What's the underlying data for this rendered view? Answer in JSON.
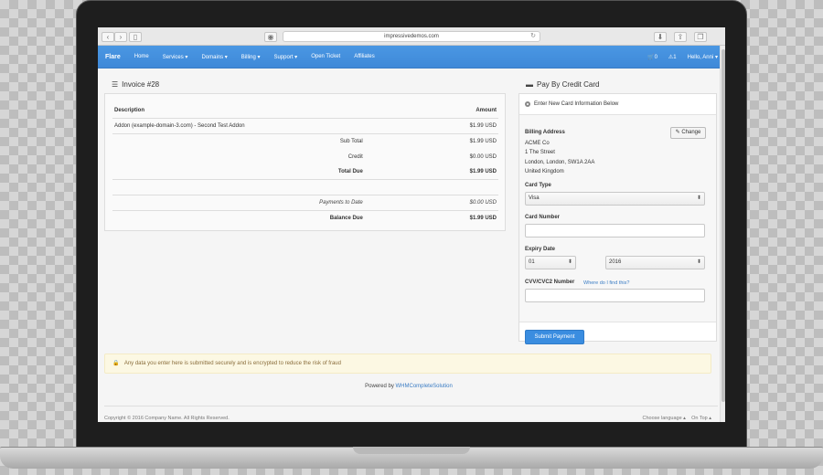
{
  "browser": {
    "url": "impressivedemos.com",
    "back_icon": "chevron-left-icon",
    "forward_icon": "chevron-right-icon"
  },
  "navbar": {
    "brand": "Flare",
    "items": [
      "Home",
      "Services ▾",
      "Domains ▾",
      "Billing ▾",
      "Support ▾",
      "Open Ticket",
      "Affiliates"
    ],
    "cart": "🛒0",
    "alerts": "⚠1",
    "user": "Hello, Anni ▾"
  },
  "invoice": {
    "title": "Invoice #28",
    "headers": {
      "description": "Description",
      "amount": "Amount"
    },
    "item": {
      "description": "Addon (example-domain-3.com) - Second Test Addon",
      "amount": "$1.99 USD"
    },
    "sub_total": {
      "label": "Sub Total",
      "value": "$1.99 USD"
    },
    "credit": {
      "label": "Credit",
      "value": "$0.00 USD"
    },
    "total_due": {
      "label": "Total Due",
      "value": "$1.99 USD"
    },
    "payments": {
      "label": "Payments to Date",
      "value": "$0.00 USD"
    },
    "balance_due": {
      "label": "Balance Due",
      "value": "$1.99 USD"
    }
  },
  "payment": {
    "title": "Pay By Credit Card",
    "enter_new": "Enter New Card Information Below",
    "billing_label": "Billing Address",
    "change_button": "✎ Change",
    "address": [
      "ACME Co",
      "1 The Street",
      "London, London, SW1A 2AA",
      "United Kingdom"
    ],
    "card_type_label": "Card Type",
    "card_type_value": "Visa",
    "card_number_label": "Card Number",
    "card_number_value": "",
    "expiry_label": "Expiry Date",
    "expiry_month": "01",
    "expiry_year": "2016",
    "cvv_label": "CVV/CVC2 Number",
    "cvv_help": "Where do I find this?",
    "cvv_value": "",
    "submit": "Submit Payment"
  },
  "alert": {
    "text": "Any data you enter here is submitted securely and is encrypted to reduce the risk of fraud"
  },
  "powered": {
    "prefix": "Powered by ",
    "link": "WHMCompleteSolution"
  },
  "footer": {
    "copyright": "Copyright © 2016 Company Name. All Rights Reserved.",
    "language": "Choose language ▴",
    "top": "On Top ▴"
  },
  "colors": {
    "navbar": "#4a97e3",
    "primary": "#3a8de0",
    "alert_bg": "#fcf8e3"
  }
}
